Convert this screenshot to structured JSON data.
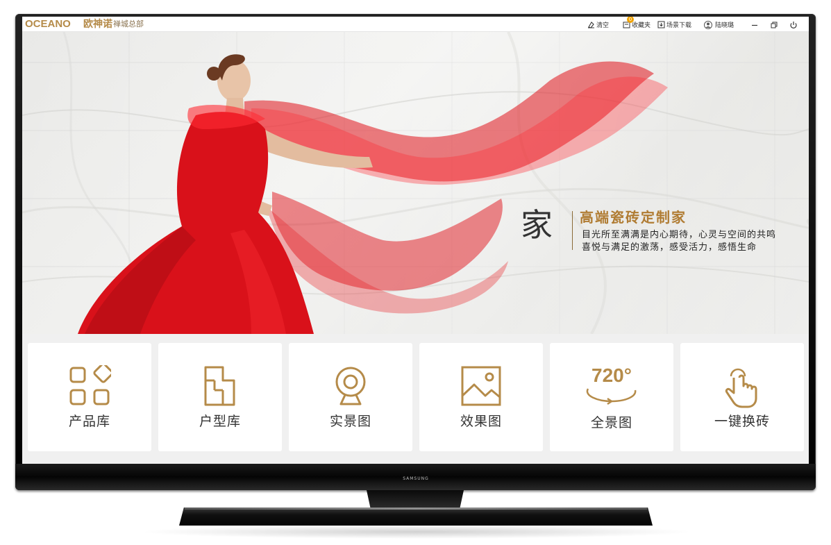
{
  "titlebar": {
    "logo": "OCEANO",
    "logo_cn": "欧神诺",
    "branch": "禅城总部",
    "clear_label": "清空",
    "fav_label": "收藏夹",
    "fav_badge": "0",
    "download_label": "场景下载",
    "user_name": "陆晓璐"
  },
  "banner": {
    "big_char": "家",
    "title": "高端瓷砖定制家",
    "line1": "目光所至满满是内心期待，心灵与空间的共鸣",
    "line2": "喜悦与满足的激荡，感受活力，感悟生命",
    "slides_count": 3,
    "active_slide": 2
  },
  "tiles": [
    {
      "label": "产品库",
      "icon": "grid-diamond-icon"
    },
    {
      "label": "户型库",
      "icon": "floorplan-icon"
    },
    {
      "label": "实景图",
      "icon": "webcam-icon"
    },
    {
      "label": "效果图",
      "icon": "image-icon"
    },
    {
      "label": "全景图",
      "icon": "panorama-720-icon",
      "icon_text": "720°"
    },
    {
      "label": "一键换砖",
      "icon": "tap-hand-icon"
    }
  ],
  "tv": {
    "brand": "SAMSUNG"
  },
  "colors": {
    "gold": "#b58b49",
    "accent": "#c69a52",
    "badge": "#f0a200",
    "dress": "#e0141c"
  }
}
